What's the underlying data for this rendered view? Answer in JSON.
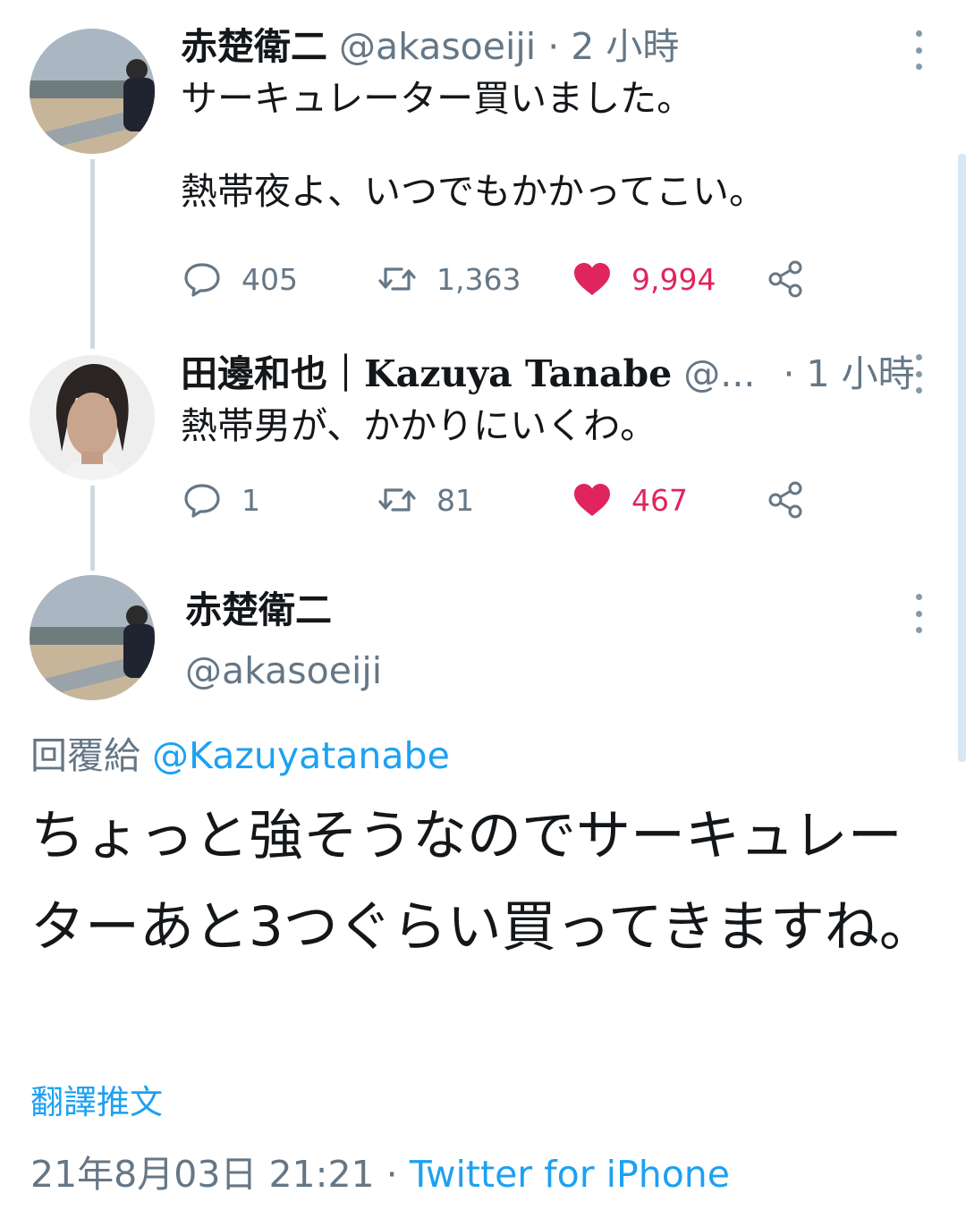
{
  "tweet1": {
    "name": "赤楚衛二",
    "handle": "@akasoeiji",
    "time": "· 2 小時",
    "text": "サーキュレーター買いました。\n\n熱帯夜よ、いつでもかかってこい。",
    "replies": "405",
    "retweets": "1,363",
    "likes": "9,994"
  },
  "tweet2": {
    "name_jp": "田邊和也｜",
    "name_en": "Kazuya Tanabe",
    "handle": "@...",
    "time": "· 1 小時",
    "text": "熱帯男が、かかりにいくわ。",
    "replies": "1",
    "retweets": "81",
    "likes": "467"
  },
  "main_tweet": {
    "name": "赤楚衛二",
    "handle": "@akasoeiji",
    "reply_label": "回覆給",
    "reply_to": "@Kazuyatanabe",
    "text": "ちょっと強そうなのでサーキュレーターあと3つぐらい買ってきますね。",
    "translate": "翻譯推文",
    "timestamp": "21年8月03日 21:21 ·",
    "source": "Twitter for iPhone"
  },
  "icons": [
    "reply-icon",
    "retweet-icon",
    "heart-icon",
    "share-icon",
    "more-icon"
  ],
  "colors": {
    "like": "#e0245e",
    "link": "#1da1f2",
    "muted": "#657786",
    "thread_line": "#cfd9de"
  }
}
